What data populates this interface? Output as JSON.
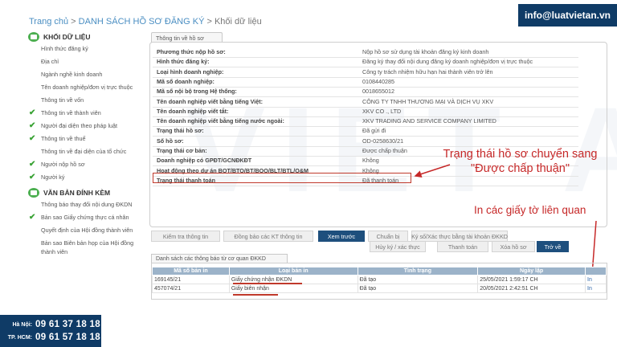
{
  "breadcrumb": {
    "home": "Trang chủ",
    "sep1": " > ",
    "list": "DANH SÁCH HỒ SƠ ĐĂNG KÝ",
    "sep2": " > ",
    "current": "Khối dữ liệu"
  },
  "brand": {
    "email": "info@luatvietan.vn",
    "watermark": "VIET AN"
  },
  "sidebar": {
    "section1": {
      "title": "KHỐI DỮ LIỆU",
      "items": [
        {
          "label": "Hình thức đăng ký",
          "checked": false
        },
        {
          "label": "Địa chỉ",
          "checked": false
        },
        {
          "label": "Ngành nghề kinh doanh",
          "checked": false
        },
        {
          "label": "Tên doanh nghiệp/đơn vị trực thuộc",
          "checked": false
        },
        {
          "label": "Thông tin về vốn",
          "checked": false
        },
        {
          "label": "Thông tin về thành viên",
          "checked": true
        },
        {
          "label": "Người đại diện theo pháp luật",
          "checked": true
        },
        {
          "label": "Thông tin về thuế",
          "checked": true
        },
        {
          "label": "Thông tin về đại diện của tổ chức",
          "checked": false
        },
        {
          "label": "Người nộp hồ sơ",
          "checked": true
        },
        {
          "label": "Người ký",
          "checked": true
        }
      ]
    },
    "section2": {
      "title": "VĂN BẢN ĐÍNH KÈM",
      "items": [
        {
          "label": "Thông báo thay đổi nội dung ĐKDN",
          "checked": false
        },
        {
          "label": "Bản sao Giấy chứng thực cá nhân",
          "checked": true
        },
        {
          "label": "Quyết định của Hội đồng thành viên",
          "checked": false
        },
        {
          "label": "Bản sao Biên bản họp của Hội đồng thành viên",
          "checked": false
        }
      ]
    }
  },
  "panel": {
    "tab": "Thông tin về hồ sơ",
    "rows": [
      {
        "label": "Phương thức nộp hồ sơ:",
        "value": "Nộp hồ sơ sử dụng tài khoản đăng ký kinh doanh"
      },
      {
        "label": "Hình thức đăng ký:",
        "value": "Đăng ký thay đổi nội dung đăng ký doanh nghiệp/đơn vị trực thuộc"
      },
      {
        "label": "Loại hình doanh nghiệp:",
        "value": "Công ty trách nhiệm hữu hạn hai thành viên trở lên"
      },
      {
        "label": "Mã số doanh nghiệp:",
        "value": "0108440285"
      },
      {
        "label": "Mã số nội bộ trong Hệ thống:",
        "value": "0018655012"
      },
      {
        "label": "Tên doanh nghiệp viết bằng tiếng Việt:",
        "value": "CÔNG TY TNHH THƯƠNG MẠI VÀ DỊCH VỤ XKV"
      },
      {
        "label": "Tên doanh nghiệp viết tắt:",
        "value": "XKV CO ., LTD"
      },
      {
        "label": "Tên doanh nghiệp viết bằng tiếng nước ngoài:",
        "value": "XKV TRADING AND SERVICE COMPANY LIMITED"
      },
      {
        "label": "Trạng thái hồ sơ:",
        "value": "Đã gửi đi"
      },
      {
        "label": "Số hồ sơ:",
        "value": "OD-0258630/21"
      },
      {
        "label": "Trạng thái cơ bản:",
        "value": "Được chấp thuận"
      },
      {
        "label": "Doanh nghiệp có GPĐT/GCNĐKĐT",
        "value": "Không"
      },
      {
        "label": "Hoạt động theo dự án BOT/BTO/BT/BOO/BLT/BTL/O&M",
        "value": "Không"
      },
      {
        "label": "Trạng thái thanh toán",
        "value": "Đã thanh toán"
      }
    ]
  },
  "annotations": {
    "status_note": "Trạng thái hồ sơ chuyển sang \"Được chấp thuận\"",
    "print_note": "In các giấy tờ liên quan"
  },
  "buttons": {
    "row1": [
      "Kiểm tra thông tin",
      "Đồng bảo các KT thông tin",
      "Xem trước",
      "Chuẩn bị",
      "Ký số/Xác thực bằng tài khoản ĐKKD"
    ],
    "row2": [
      "Hủy ký / xác thực",
      "Thanh toán",
      "Xóa hồ sơ",
      "Trở về"
    ]
  },
  "notices": {
    "tab": "Danh sách các thông báo từ cơ quan ĐKKD",
    "columns": [
      "Mã số bản in",
      "Loại bản in",
      "Tình trạng",
      "Ngày lập",
      ""
    ],
    "rows": [
      {
        "code": "169145/21",
        "type": "Giấy chứng nhận ĐKDN",
        "status": "Đã tạo",
        "date": "25/05/2021 1:59:17 CH",
        "action": "In"
      },
      {
        "code": "457074/21",
        "type": "Giấy biên nhận",
        "status": "Đã tạo",
        "date": "20/05/2021 2:42:51 CH",
        "action": "In"
      }
    ]
  },
  "hotline": [
    {
      "city": "Hà Nội:",
      "number": "09 61 37 18 18"
    },
    {
      "city": "TP. HCM:",
      "number": "09 61 57 18 18"
    }
  ],
  "colors": {
    "accent": "#1e4f7d",
    "annotation": "#c62828",
    "check": "#3aa335"
  }
}
